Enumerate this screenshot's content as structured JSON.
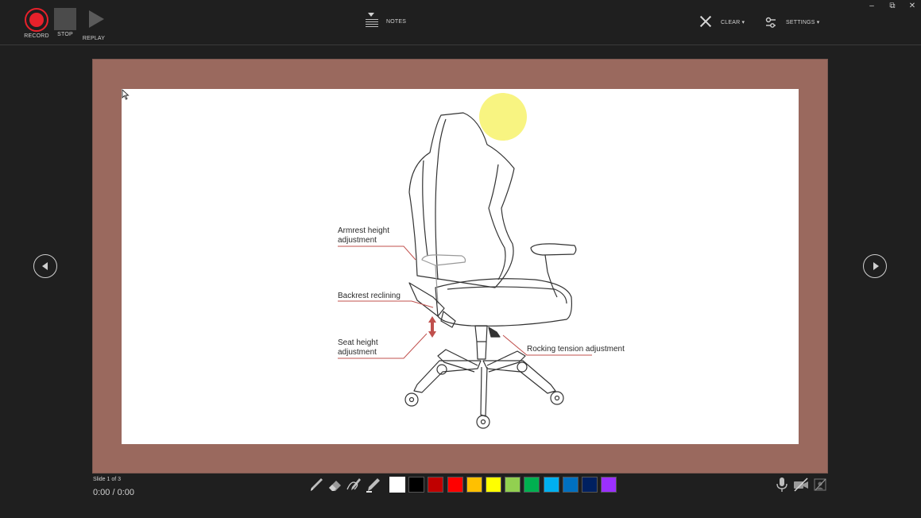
{
  "toolbar": {
    "record_label": "RECORD",
    "stop_label": "STOP",
    "replay_label": "REPLAY",
    "notes_label": "NOTES",
    "clear_label": "CLEAR ▾",
    "settings_label": "SETTINGS ▾"
  },
  "window_controls": {
    "minimize": "–",
    "restore": "⧉",
    "close": "✕"
  },
  "slide": {
    "captions": {
      "armrest": "Armrest height\nadjustment",
      "backrest": "Backrest reclining",
      "seat": "Seat height\nadjustment",
      "rocking": "Rocking tension adjustment"
    }
  },
  "status": {
    "slide_counter": "Slide 1 of 3",
    "timer": "0:00 / 0:00"
  },
  "pen_tools": [
    "pen-icon",
    "eraser-icon",
    "pen-with-line-icon",
    "highlighter-icon"
  ],
  "ink_colors": [
    "#ffffff",
    "#000000",
    "#c00000",
    "#ff0000",
    "#ffc000",
    "#ffff00",
    "#92d050",
    "#00b050",
    "#00b0f0",
    "#0070c0",
    "#002060",
    "#9b30ff"
  ],
  "media_icons": [
    "microphone-icon",
    "camera-off-icon",
    "camera-preview-off-icon"
  ]
}
